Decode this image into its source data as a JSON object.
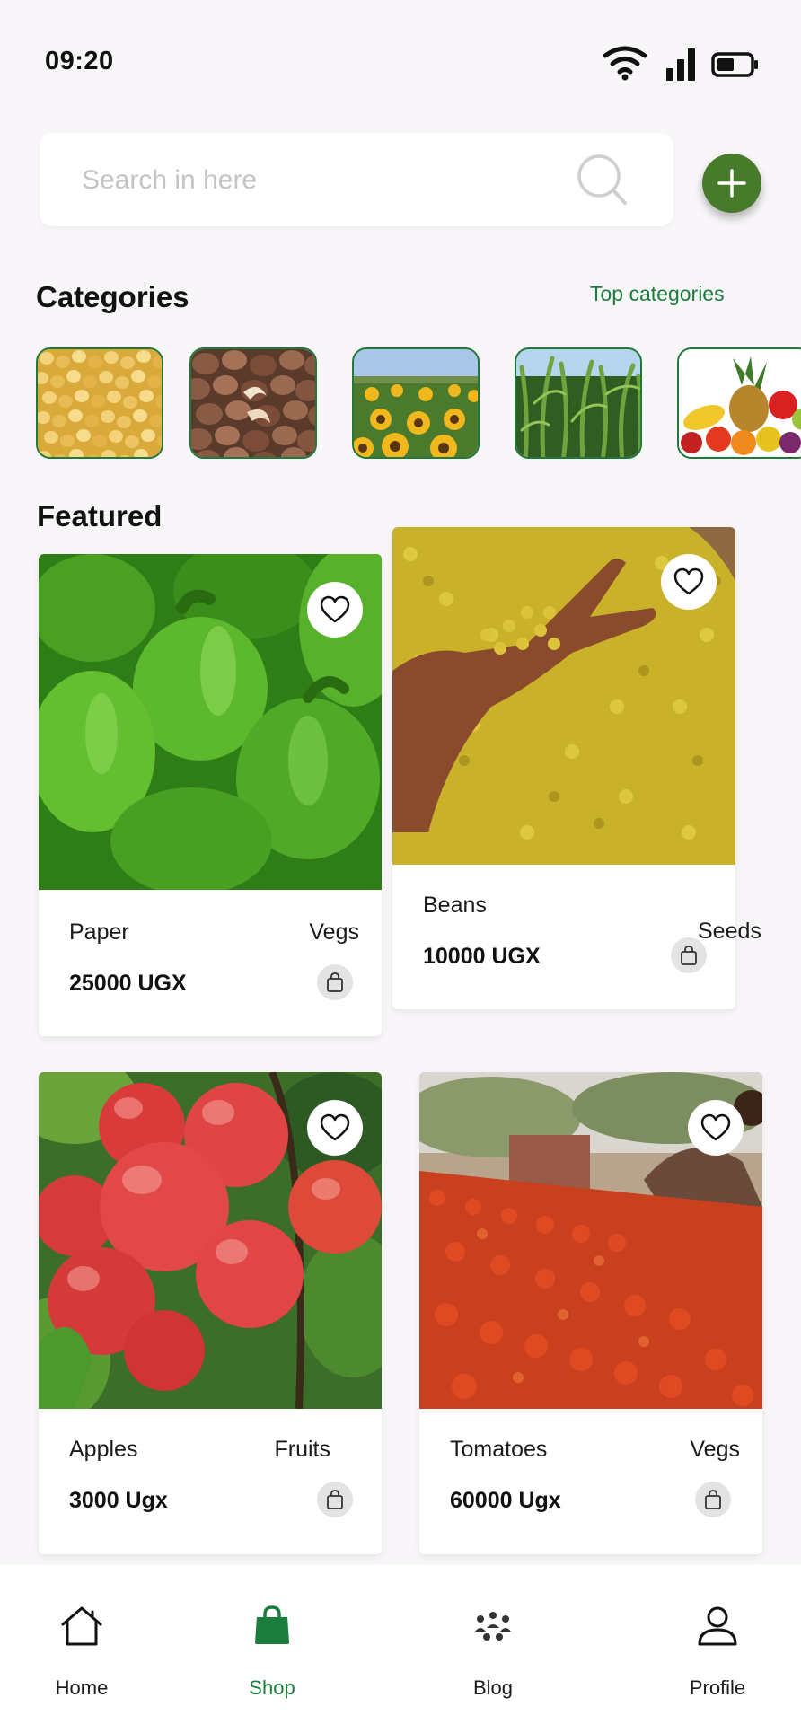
{
  "status_bar": {
    "time": "09:20"
  },
  "search": {
    "placeholder": "Search in here"
  },
  "categories": {
    "title": "Categories",
    "link": "Top categories",
    "items": [
      {
        "name": "maize-category"
      },
      {
        "name": "cashew-category"
      },
      {
        "name": "sunflower-category"
      },
      {
        "name": "maize-field-category"
      },
      {
        "name": "fruits-category"
      }
    ]
  },
  "featured": {
    "title": "Featured",
    "products": [
      {
        "name": "Paper",
        "category": "Vegs",
        "price": "25000 UGX"
      },
      {
        "name": "Beans",
        "category": "Seeds",
        "price": "10000  UGX"
      },
      {
        "name": "Apples",
        "category": "Fruits",
        "price": "3000 Ugx"
      },
      {
        "name": "Tomatoes",
        "category": "Vegs",
        "price": "60000 Ugx"
      }
    ]
  },
  "nav": {
    "items": [
      {
        "label": "Home"
      },
      {
        "label": "Shop"
      },
      {
        "label": "Blog"
      },
      {
        "label": "Profile"
      }
    ]
  },
  "colors": {
    "accent": "#1b7d3c",
    "add_button": "#487a2b",
    "background": "#f8f6f8"
  }
}
